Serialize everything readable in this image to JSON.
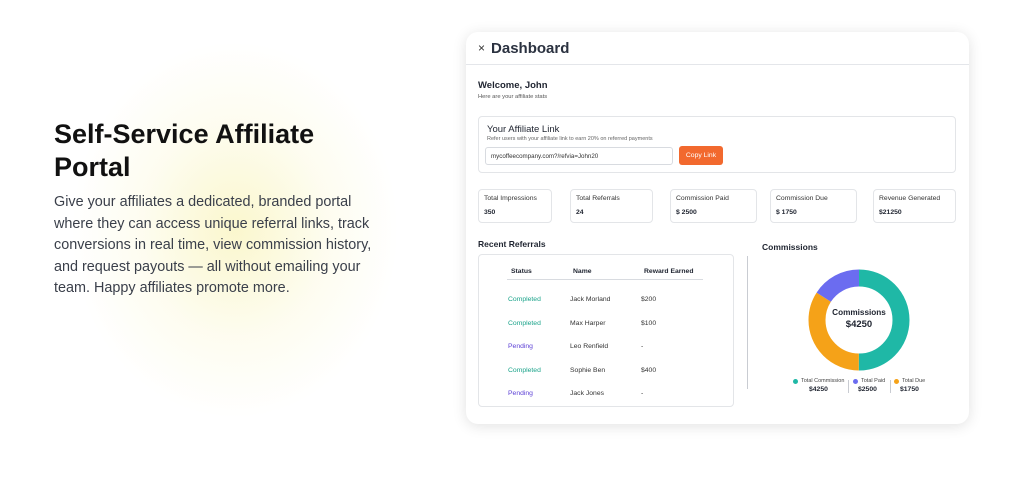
{
  "hero": {
    "title": "Self-Service Affiliate Portal",
    "description": "Give your affiliates a dedicated, branded portal where they can access unique referral links, track conversions in real time, view commission history, and request payouts — all without emailing your team. Happy affiliates promote more."
  },
  "dashboard": {
    "close_glyph": "×",
    "title": "Dashboard",
    "welcome": "Welcome, John",
    "welcome_sub": "Here are your affiliate stats",
    "affiliate_link": {
      "title": "Your Affiliate Link",
      "subtitle": "Refer users with your affiliate link to earn 20% on referred payments",
      "value": "mycoffeecompany.com?/refvia=John20",
      "copy_label": "Copy Link"
    },
    "stats": [
      {
        "label": "Total Impressions",
        "value": "350"
      },
      {
        "label": "Total Referrals",
        "value": "24"
      },
      {
        "label": "Commission Paid",
        "value": "$ 2500"
      },
      {
        "label": "Commission Due",
        "value": "$ 1750"
      },
      {
        "label": "Revenue Generated",
        "value": "$21250"
      }
    ],
    "referrals": {
      "title": "Recent Referrals",
      "headers": [
        "Status",
        "Name",
        "Reward Earned"
      ],
      "rows": [
        {
          "status": "Completed",
          "name": "Jack Morland",
          "reward": "$200"
        },
        {
          "status": "Completed",
          "name": "Max Harper",
          "reward": "$100"
        },
        {
          "status": "Pending",
          "name": "Leo Renfield",
          "reward": "-"
        },
        {
          "status": "Completed",
          "name": "Sophie Ben",
          "reward": "$400"
        },
        {
          "status": "Pending",
          "name": "Jack Jones",
          "reward": "-"
        }
      ]
    },
    "commissions": {
      "title": "Commissions",
      "center_label": "Commissions",
      "center_value": "$4250",
      "legend": [
        {
          "label": "Total Commission",
          "value": "$4250",
          "color": "#1fb8a6"
        },
        {
          "label": "Total Paid",
          "value": "$2500",
          "color": "#6b6cf0"
        },
        {
          "label": "Total Due",
          "value": "$1750",
          "color": "#f5a218"
        }
      ]
    }
  },
  "chart_data": {
    "type": "pie",
    "title": "Commissions",
    "categories": [
      "Teal segment",
      "Orange segment",
      "Blue segment"
    ],
    "values": [
      50,
      34,
      16
    ],
    "colors": [
      "#1fb8a6",
      "#f5a218",
      "#6b6cf0"
    ]
  }
}
